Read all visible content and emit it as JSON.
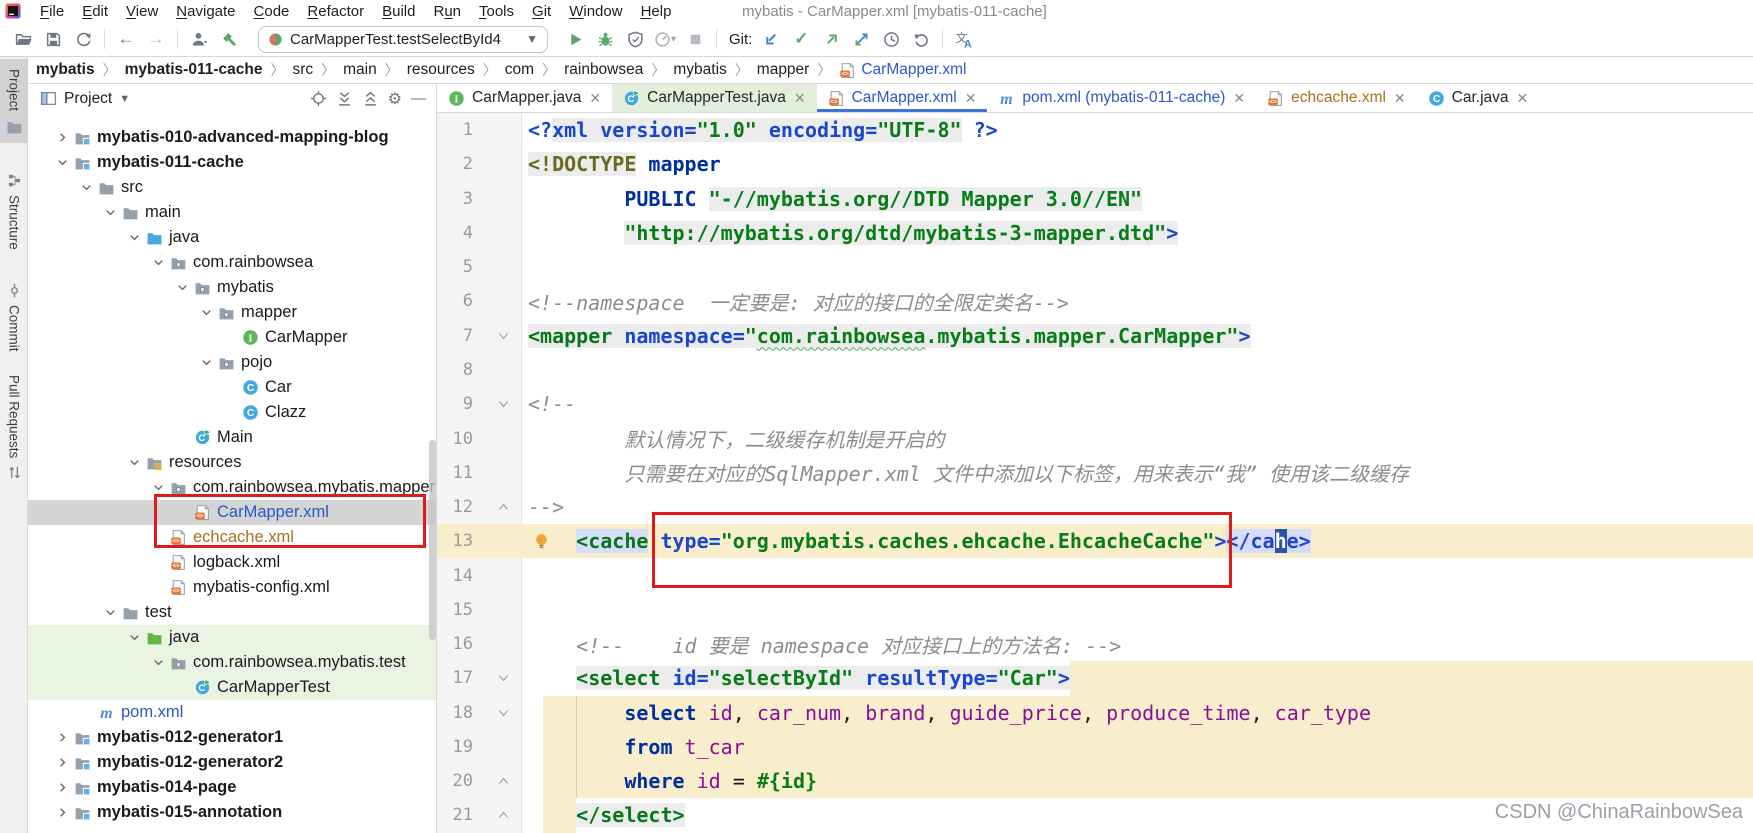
{
  "titlebar": {
    "title": "mybatis - CarMapper.xml [mybatis-011-cache]",
    "menus": [
      [
        "File",
        0
      ],
      [
        "Edit",
        0
      ],
      [
        "View",
        0
      ],
      [
        "Navigate",
        0
      ],
      [
        "Code",
        0
      ],
      [
        "Refactor",
        0
      ],
      [
        "Build",
        0
      ],
      [
        "Run",
        1
      ],
      [
        "Tools",
        0
      ],
      [
        "Git",
        0
      ],
      [
        "Window",
        0
      ],
      [
        "Help",
        0
      ]
    ]
  },
  "toolbar": {
    "run_config": "CarMapperTest.testSelectById4",
    "git_label": "Git:",
    "file_icons": [
      "open-folder",
      "save",
      "sync"
    ],
    "nav_icons": [
      "back-arrow",
      "forward-arrow"
    ],
    "build_icons": [
      "user",
      "hammer"
    ],
    "run_icons": [
      "play",
      "debug",
      "coverage",
      "profiler",
      "stop"
    ],
    "git_icons": [
      "git-update",
      "git-commit",
      "git-push",
      "git-diff",
      "history",
      "rollback"
    ],
    "misc_icons": [
      "translate"
    ]
  },
  "breadcrumb": [
    "mybatis",
    "mybatis-011-cache",
    "src",
    "main",
    "resources",
    "com",
    "rainbowsea",
    "mybatis",
    "mapper",
    "CarMapper.xml"
  ],
  "stripe": {
    "items": [
      "Project",
      "Structure",
      "Commit",
      "Pull Requests"
    ]
  },
  "project_panel": {
    "title": "Project",
    "header_icons": [
      "locate",
      "expand-all",
      "collapse-all",
      "settings-gear",
      "hide-minus"
    ]
  },
  "tree": [
    {
      "label": "mybatis-010-advanced-mapping-blog",
      "level": 0,
      "icon": "module-folder",
      "chev": "r",
      "bold": true
    },
    {
      "label": "mybatis-011-cache",
      "level": 0,
      "icon": "module-folder",
      "chev": "d",
      "bold": true
    },
    {
      "label": "src",
      "level": 1,
      "icon": "folder",
      "chev": "d"
    },
    {
      "label": "main",
      "level": 2,
      "icon": "folder",
      "chev": "d"
    },
    {
      "label": "java",
      "level": 3,
      "icon": "source-folder",
      "chev": "d"
    },
    {
      "label": "com.rainbowsea",
      "level": 4,
      "icon": "package",
      "chev": "d"
    },
    {
      "label": "mybatis",
      "level": 5,
      "icon": "package",
      "chev": "d"
    },
    {
      "label": "mapper",
      "level": 6,
      "icon": "package",
      "chev": "d"
    },
    {
      "label": "CarMapper",
      "level": 7,
      "icon": "interface"
    },
    {
      "label": "pojo",
      "level": 6,
      "icon": "package",
      "chev": "d"
    },
    {
      "label": "Car",
      "level": 7,
      "icon": "class"
    },
    {
      "label": "Clazz",
      "level": 7,
      "icon": "class"
    },
    {
      "label": "Main",
      "level": 5,
      "icon": "class-run"
    },
    {
      "label": "resources",
      "level": 3,
      "icon": "resources-folder",
      "chev": "d"
    },
    {
      "label": "com.rainbowsea.mybatis.mapper",
      "level": 4,
      "icon": "package",
      "chev": "d"
    },
    {
      "label": "CarMapper.xml",
      "level": 5,
      "icon": "xml-file",
      "color": "blue",
      "selected": true
    },
    {
      "label": "echcache.xml",
      "level": 4,
      "icon": "xml-file",
      "color": "orange"
    },
    {
      "label": "logback.xml",
      "level": 4,
      "icon": "xml-file"
    },
    {
      "label": "mybatis-config.xml",
      "level": 4,
      "icon": "xml-file"
    },
    {
      "label": "test",
      "level": 2,
      "icon": "folder",
      "chev": "d"
    },
    {
      "label": "java",
      "level": 3,
      "icon": "test-folder",
      "chev": "d",
      "green": true
    },
    {
      "label": "com.rainbowsea.mybatis.test",
      "level": 4,
      "icon": "package",
      "chev": "d",
      "green": true
    },
    {
      "label": "CarMapperTest",
      "level": 5,
      "icon": "class-run",
      "green": true
    },
    {
      "label": "pom.xml",
      "level": 1,
      "icon": "maven",
      "color": "blue"
    },
    {
      "label": "mybatis-012-generator1",
      "level": 0,
      "icon": "module-folder",
      "chev": "r",
      "bold": true
    },
    {
      "label": "mybatis-012-generator2",
      "level": 0,
      "icon": "module-folder",
      "chev": "r",
      "bold": true
    },
    {
      "label": "mybatis-014-page",
      "level": 0,
      "icon": "module-folder",
      "chev": "r",
      "bold": true
    },
    {
      "label": "mybatis-015-annotation",
      "level": 0,
      "icon": "module-folder",
      "chev": "r",
      "bold": true
    }
  ],
  "tabs": [
    {
      "label": "CarMapper.java",
      "icon": "interface"
    },
    {
      "label": "CarMapperTest.java",
      "icon": "class-run",
      "green": true
    },
    {
      "label": "CarMapper.xml",
      "icon": "xml-file",
      "active": true,
      "color": "blue"
    },
    {
      "label": "pom.xml (mybatis-011-cache)",
      "icon": "maven",
      "color": "blue"
    },
    {
      "label": "echcache.xml",
      "icon": "xml-file",
      "color": "orange"
    },
    {
      "label": "Car.java",
      "icon": "class"
    }
  ],
  "editor": {
    "lines": [
      {
        "n": 1,
        "segs": [
          [
            "<?",
            "b"
          ],
          [
            "xml ",
            "b",
            "G"
          ],
          [
            "version=",
            "b",
            "G"
          ],
          [
            "\"1.0\"",
            "s",
            "G"
          ],
          [
            " ",
            "pl",
            "G"
          ],
          [
            "encoding=",
            "b",
            "G"
          ],
          [
            "\"UTF-8\"",
            "s",
            "G"
          ],
          [
            " ?>",
            "b"
          ]
        ]
      },
      {
        "n": 2,
        "segs": [
          [
            "<!DOCTYPE",
            "d",
            "G"
          ],
          [
            " ",
            "pl"
          ],
          [
            "mapper",
            "n"
          ]
        ]
      },
      {
        "n": 3,
        "segs": [
          [
            "        ",
            "pl"
          ],
          [
            "PUBLIC",
            "n"
          ],
          [
            " ",
            "pl"
          ],
          [
            "\"-//mybatis.org//DTD Mapper 3.0//EN\"",
            "s",
            "G"
          ]
        ]
      },
      {
        "n": 4,
        "segs": [
          [
            "        ",
            "pl"
          ],
          [
            "\"http://mybatis.org/dtd/mybatis-3-mapper.dtd\"",
            "s",
            "G"
          ],
          [
            ">",
            "b",
            "G"
          ]
        ]
      },
      {
        "n": 5,
        "segs": []
      },
      {
        "n": 6,
        "segs": [
          [
            "<!--namespace  一定要是: 对应的接口的全限定类名-->",
            "c"
          ]
        ]
      },
      {
        "n": 7,
        "fold": "d",
        "segs": [
          [
            "<mapper ",
            "t",
            "G"
          ],
          [
            "namespace=",
            "b",
            "G"
          ],
          [
            "\"",
            "s",
            "G"
          ],
          [
            "com.rainbowsea",
            "s",
            "G",
            "wavy"
          ],
          [
            ".mybatis.mapper.CarMapper\"",
            "s",
            "G"
          ],
          [
            ">",
            "b",
            "G"
          ]
        ]
      },
      {
        "n": 8,
        "segs": []
      },
      {
        "n": 9,
        "fold": "d",
        "segs": [
          [
            "<!--",
            "c"
          ]
        ]
      },
      {
        "n": 10,
        "segs": [
          [
            "        默认情况下，二级缓存机制是开启的",
            "c"
          ]
        ]
      },
      {
        "n": 11,
        "segs": [
          [
            "        只需要在对应的SqlMapper.xml 文件中添加以下标签，用来表示“我” 使用该二级缓存",
            "c"
          ]
        ]
      },
      {
        "n": 12,
        "fold": "u",
        "segs": [
          [
            "-->",
            "c"
          ]
        ]
      },
      {
        "n": 13,
        "bulb": true,
        "fill": {
          "l": 0
        },
        "segs": [
          [
            "    ",
            "pl"
          ],
          [
            "<cache",
            "t",
            "L"
          ],
          [
            " ",
            "pl"
          ],
          [
            "type=",
            "b"
          ],
          [
            "\"org.mybatis.caches.ehcache.EhcacheCache\"",
            "s"
          ],
          [
            ">",
            "b"
          ],
          [
            "</ca",
            "ct",
            "L"
          ],
          [
            "h",
            "ct",
            "S"
          ],
          [
            "e>",
            "ct",
            "L"
          ]
        ]
      },
      {
        "n": 14,
        "segs": []
      },
      {
        "n": 15,
        "segs": []
      },
      {
        "n": 16,
        "segs": [
          [
            "    ",
            "pl"
          ],
          [
            "<!--    id 要是 namespace 对应接口上的方法名: -->",
            "c"
          ]
        ]
      },
      {
        "n": 17,
        "fold": "d",
        "fill": {
          "l": 633
        },
        "segs": [
          [
            "    ",
            "pl"
          ],
          [
            "<select ",
            "t",
            "G"
          ],
          [
            "id=",
            "b",
            "G"
          ],
          [
            "\"selectById\"",
            "s",
            "G"
          ],
          [
            " ",
            "pl",
            "G"
          ],
          [
            "resultType=",
            "b",
            "G"
          ],
          [
            "\"Car\"",
            "s",
            "G"
          ],
          [
            ">",
            "b",
            "G"
          ]
        ]
      },
      {
        "n": 18,
        "fold": "d",
        "fill": {
          "l": 106
        },
        "guide": true,
        "segs": [
          [
            "        ",
            "pl"
          ],
          [
            "select",
            "k"
          ],
          [
            " ",
            "pl"
          ],
          [
            "id",
            "p"
          ],
          [
            ", ",
            "pl"
          ],
          [
            "car_num",
            "p"
          ],
          [
            ", ",
            "pl"
          ],
          [
            "brand",
            "p"
          ],
          [
            ", ",
            "pl"
          ],
          [
            "guide_price",
            "p"
          ],
          [
            ", ",
            "pl"
          ],
          [
            "produce_time",
            "p"
          ],
          [
            ", ",
            "pl"
          ],
          [
            "car_type",
            "p"
          ]
        ]
      },
      {
        "n": 19,
        "fill": {
          "l": 106
        },
        "guide": true,
        "segs": [
          [
            "        ",
            "pl"
          ],
          [
            "from",
            "k"
          ],
          [
            " ",
            "pl"
          ],
          [
            "t_car",
            "p"
          ]
        ]
      },
      {
        "n": 20,
        "fold": "u",
        "fill": {
          "l": 106
        },
        "guide": true,
        "segs": [
          [
            "        ",
            "pl"
          ],
          [
            "where",
            "k"
          ],
          [
            " ",
            "pl"
          ],
          [
            "id",
            "p"
          ],
          [
            " = ",
            "pl"
          ],
          [
            "#{",
            "s"
          ],
          [
            "id",
            "s"
          ],
          [
            "}",
            "s"
          ]
        ]
      },
      {
        "n": 21,
        "fold": "u",
        "fill": {
          "l": 106,
          "w": 33
        },
        "segs": [
          [
            "    ",
            "pl"
          ],
          [
            "</select>",
            "t",
            "G"
          ]
        ]
      }
    ]
  },
  "annotations": {
    "tree_highlight_box": "red box around CarMapper.xml and echcache.xml",
    "editor_highlight_box": "red box around cache type attribute"
  },
  "watermark": "CSDN @ChinaRainbowSea",
  "colors": {
    "accent_blue": "#3d74d6",
    "annotation_red": "#de1b1b",
    "tag_green": "#08761a",
    "string_green": "#067d17",
    "attr_blue": "#1846cf",
    "keyword_navy": "#002f9e",
    "sql_purple": "#871094",
    "comment_gray": "#8c8c8c",
    "injection_yellow": "#f8eecb",
    "tag_match_lavender": "#d6ddf7",
    "selection_blue": "#2d55a5",
    "test_tab_green": "#e2efdc",
    "tree_selection_gray": "#d4d4d4",
    "tree_test_green": "#e9f4e2"
  }
}
